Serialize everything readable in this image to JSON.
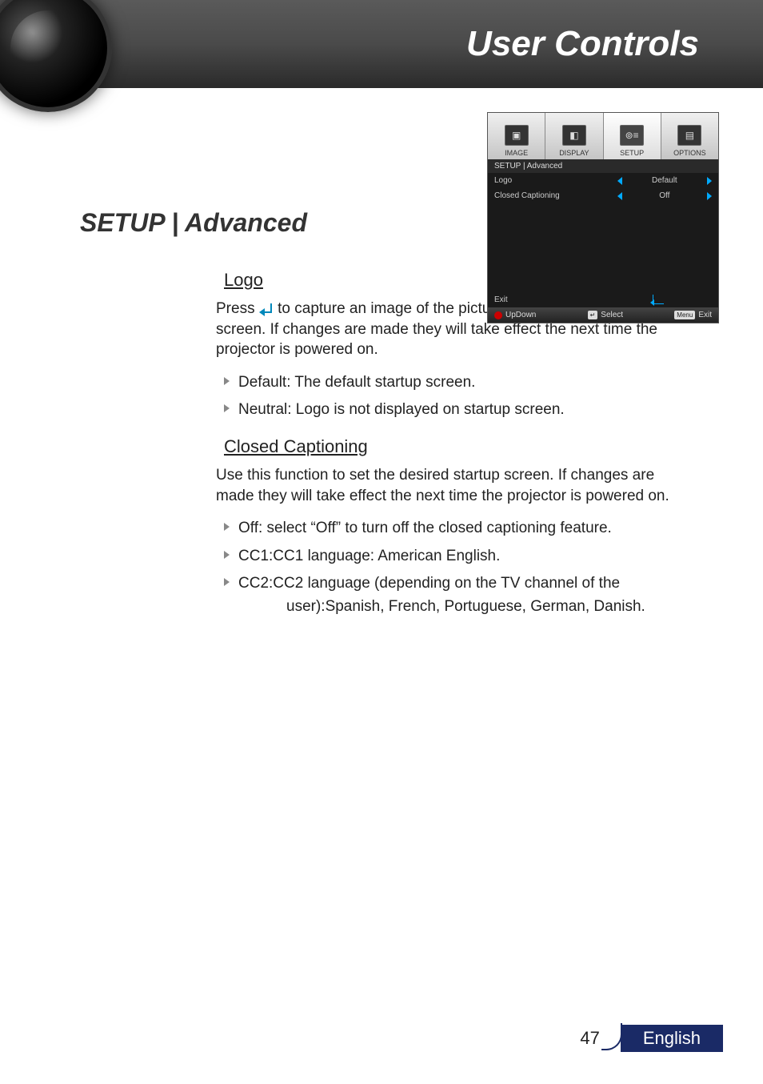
{
  "header": {
    "title": "User Controls"
  },
  "section_title": "SETUP | Advanced",
  "osd": {
    "tabs": [
      {
        "label": "IMAGE"
      },
      {
        "label": "DISPLAY"
      },
      {
        "label": "SETUP"
      },
      {
        "label": "OPTIONS"
      }
    ],
    "breadcrumb": "SETUP  |  Advanced",
    "rows": [
      {
        "label": "Logo",
        "value": "Default"
      },
      {
        "label": "Closed Captioning",
        "value": "Off"
      }
    ],
    "exit_label": "Exit",
    "footer": {
      "updown": "UpDown",
      "select": "Select",
      "menu_key": "Menu",
      "exit": "Exit"
    }
  },
  "body": {
    "logo": {
      "heading": "Logo",
      "para_before": "Press ",
      "para_after": " to capture an image of the picture currently displayed on screen. If changes are made they will take effect the next time the projector is powered on.",
      "bullets": [
        "Default: The default startup screen.",
        "Neutral: Logo is not displayed on startup screen."
      ]
    },
    "cc": {
      "heading": "Closed Captioning",
      "para": "Use this function to set the desired startup screen. If changes are made they will take effect the next time the projector is powered on.",
      "bullets": [
        "Off: select “Off” to turn off the closed captioning feature.",
        "CC1:CC1 language: American English."
      ],
      "bullet3_line1": "CC2:CC2 language (depending on the TV channel of the ",
      "bullet3_line2": "user):Spanish, French, Portuguese, German, Danish."
    }
  },
  "footer": {
    "page": "47",
    "lang": "English"
  }
}
